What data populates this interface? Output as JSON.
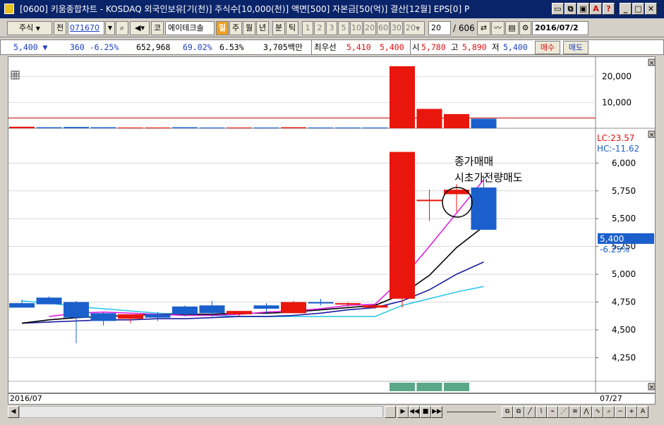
{
  "window": {
    "title": "[0600] 키움종합차트 - KOSDAQ 외국인보유[기(천)] 주식수[10,000(천)] 액면[500] 자본금[50(억)] 결산[12월] EPS[0] P",
    "controls": [
      "▭",
      "⧉",
      "▣",
      "A",
      "?",
      "_",
      "□",
      "✕"
    ]
  },
  "toolbar": {
    "market": "주식",
    "scope": "전",
    "code": "071670",
    "kor": "코",
    "stock_name": "에이테크솔",
    "periods": [
      "일",
      "주",
      "월",
      "년",
      "분",
      "틱"
    ],
    "minutes": [
      "1",
      "2",
      "3",
      "5",
      "10",
      "20",
      "60",
      "30",
      "20"
    ],
    "count": "20",
    "total": "/ 606",
    "date": "2016/07/2"
  },
  "quote": {
    "price": "5,400 ▼",
    "change": "360 -6.25%",
    "volume": "652,968",
    "vol_ratio": "69.02%",
    "turnover": "6.53%",
    "amount": "3,705백만",
    "best_label": "최우선",
    "best_ask": "5,410",
    "best_bid": "5,400",
    "open_label": "시",
    "open": "5,780",
    "high_label": "고",
    "high": "5,890",
    "low_label": "저",
    "low": "5,400",
    "buy": "매수",
    "sell": "매도"
  },
  "annotations": {
    "line1": "종가매매",
    "line2": "시초가전량매도"
  },
  "volume_axis": [
    "20,000",
    "10,000"
  ],
  "price_axis": [
    "6,000",
    "5,750",
    "5,500",
    "5,250",
    "5,000",
    "4,750",
    "4,500",
    "4,250"
  ],
  "price_box": {
    "price": "5,400",
    "pct": "-6.25%"
  },
  "lc": "LC:23.57",
  "hc": "HC:-11.62",
  "date_left": "2016/07",
  "date_right": "07/27",
  "colors": {
    "up": "#e8160c",
    "down": "#1a5fcc",
    "ma5": "#e020e0",
    "ma10": "#000000",
    "ma20": "#1a1aa0",
    "ma60": "#30c8e8"
  },
  "chart_data": {
    "type": "candlestick",
    "candles": [
      {
        "o": 4740,
        "h": 4770,
        "l": 4720,
        "c": 4700
      },
      {
        "o": 4790,
        "h": 4800,
        "l": 4730,
        "c": 4730
      },
      {
        "o": 4750,
        "h": 4760,
        "l": 4380,
        "c": 4610
      },
      {
        "o": 4650,
        "h": 4660,
        "l": 4540,
        "c": 4580
      },
      {
        "o": 4600,
        "h": 4640,
        "l": 4560,
        "c": 4640
      },
      {
        "o": 4640,
        "h": 4660,
        "l": 4580,
        "c": 4610
      },
      {
        "o": 4710,
        "h": 4720,
        "l": 4620,
        "c": 4640
      },
      {
        "o": 4720,
        "h": 4760,
        "l": 4620,
        "c": 4650
      },
      {
        "o": 4640,
        "h": 4670,
        "l": 4620,
        "c": 4670
      },
      {
        "o": 4720,
        "h": 4740,
        "l": 4640,
        "c": 4690
      },
      {
        "o": 4650,
        "h": 4760,
        "l": 4650,
        "c": 4750
      },
      {
        "o": 4750,
        "h": 4780,
        "l": 4720,
        "c": 4740
      },
      {
        "o": 4730,
        "h": 4750,
        "l": 4710,
        "c": 4740
      },
      {
        "o": 4700,
        "h": 4730,
        "l": 4690,
        "c": 4720
      },
      {
        "o": 4780,
        "h": 6100,
        "l": 4700,
        "c": 6100
      },
      {
        "o": 5670,
        "h": 5760,
        "l": 5480,
        "c": 5670
      },
      {
        "o": 5720,
        "h": 5810,
        "l": 5560,
        "c": 5760
      },
      {
        "o": 5780,
        "h": 5890,
        "l": 5400,
        "c": 5400
      }
    ],
    "volumes": [
      {
        "v": 600,
        "c": "up"
      },
      {
        "v": 400,
        "c": "down"
      },
      {
        "v": 500,
        "c": "down"
      },
      {
        "v": 400,
        "c": "down"
      },
      {
        "v": 300,
        "c": "up"
      },
      {
        "v": 300,
        "c": "up"
      },
      {
        "v": 400,
        "c": "down"
      },
      {
        "v": 300,
        "c": "down"
      },
      {
        "v": 300,
        "c": "up"
      },
      {
        "v": 300,
        "c": "down"
      },
      {
        "v": 400,
        "c": "up"
      },
      {
        "v": 300,
        "c": "down"
      },
      {
        "v": 300,
        "c": "down"
      },
      {
        "v": 300,
        "c": "down"
      },
      {
        "v": 24000,
        "c": "up"
      },
      {
        "v": 7500,
        "c": "up"
      },
      {
        "v": 5500,
        "c": "up"
      },
      {
        "v": 3700,
        "c": "down"
      }
    ],
    "volume_ref": 4000,
    "ma5": [
      null,
      4620,
      4650,
      4660,
      4650,
      4640,
      4630,
      4630,
      4640,
      4660,
      4670,
      4690,
      4720,
      4730,
      4960,
      5250,
      5550,
      5850
    ],
    "ma10": [
      4560,
      4590,
      4610,
      4620,
      4630,
      4640,
      4640,
      4640,
      4650,
      4650,
      4660,
      4680,
      4700,
      4720,
      4820,
      4990,
      5240,
      5430
    ],
    "ma20": [
      4560,
      4570,
      4580,
      4590,
      4590,
      4600,
      4600,
      4610,
      4620,
      4620,
      4630,
      4650,
      4680,
      4700,
      4760,
      4860,
      5000,
      5110
    ],
    "ma60": [
      4760,
      4740,
      4710,
      4690,
      4670,
      4650,
      4640,
      4630,
      4620,
      4620,
      4620,
      4620,
      4620,
      4620,
      4720,
      4780,
      4840,
      4890
    ],
    "ylim": [
      4050,
      6300
    ],
    "vol_ylim": [
      0,
      27000
    ]
  }
}
